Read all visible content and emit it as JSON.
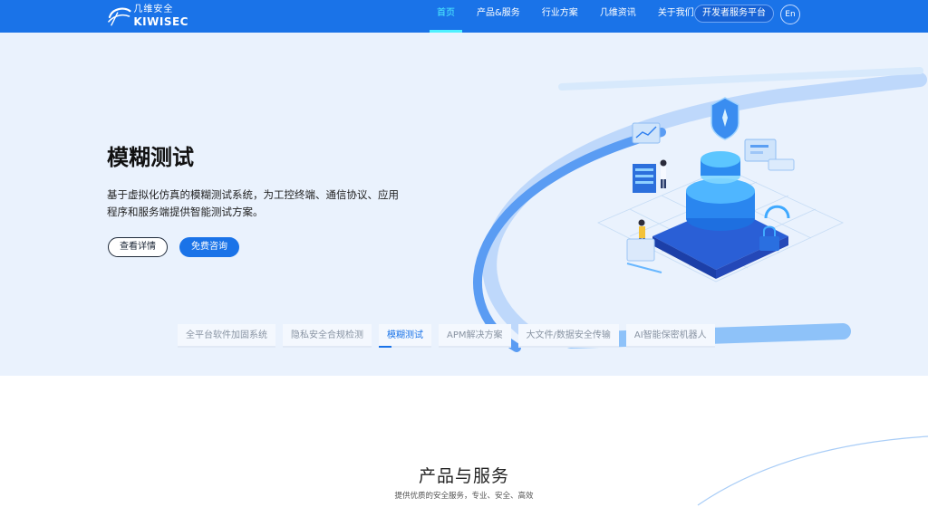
{
  "header": {
    "logo_cn": "几维安全",
    "logo_en": "KIWISEC",
    "nav": [
      {
        "label": "首页",
        "active": true
      },
      {
        "label": "产品&服务",
        "active": false
      },
      {
        "label": "行业方案",
        "active": false
      },
      {
        "label": "几维资讯",
        "active": false
      },
      {
        "label": "关于我们",
        "active": false
      }
    ],
    "dev_platform": "开发者服务平台",
    "lang": "En"
  },
  "hero": {
    "title": "模糊测试",
    "description": "基于虚拟化仿真的模糊测试系统，为工控终端、通信协议、应用程序和服务端提供智能测试方案。",
    "detail_button": "查看详情",
    "consult_button": "免费咨询"
  },
  "tabs": [
    {
      "label": "全平台软件加固系统",
      "active": false
    },
    {
      "label": "隐私安全合规检测",
      "active": false
    },
    {
      "label": "模糊测试",
      "active": true
    },
    {
      "label": "APM解决方案",
      "active": false
    },
    {
      "label": "大文件/数据安全传输",
      "active": false
    },
    {
      "label": "AI智能保密机器人",
      "active": false
    }
  ],
  "section": {
    "title": "产品与服务",
    "subtitle": "提供优质的安全服务，专业、安全、高效"
  },
  "colors": {
    "brand": "#1a73e8",
    "nav_active": "#4ff1ff",
    "hero_bg": "#eaf2fd"
  }
}
